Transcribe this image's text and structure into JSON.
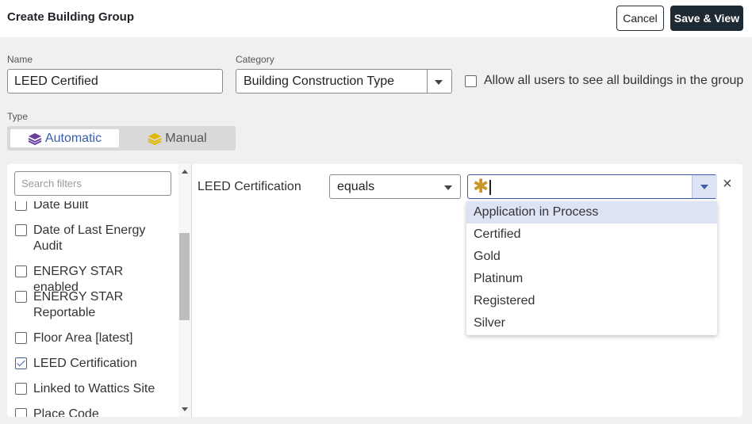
{
  "header": {
    "title": "Create Building Group",
    "cancel_label": "Cancel",
    "save_label": "Save & View"
  },
  "form": {
    "name_label": "Name",
    "name_value": "LEED Certified",
    "category_label": "Category",
    "category_value": "Building Construction Type",
    "allow_all_label": "Allow all users to see all buildings in the group",
    "allow_all_checked": false,
    "type_label": "Type",
    "type_automatic": "Automatic",
    "type_manual": "Manual",
    "type_selected": "Automatic"
  },
  "filters": {
    "search_placeholder": "Search filters",
    "items": [
      {
        "label": "Date Built",
        "checked": false
      },
      {
        "label": "Date of Last Energy Audit",
        "checked": false
      },
      {
        "label": "ENERGY STAR enabled",
        "checked": false
      },
      {
        "label": "ENERGY STAR Reportable",
        "checked": false
      },
      {
        "label": "Floor Area [latest]",
        "checked": false
      },
      {
        "label": "LEED Certification",
        "checked": true
      },
      {
        "label": "Linked to Wattics Site",
        "checked": false
      },
      {
        "label": "Place Code",
        "checked": false
      }
    ]
  },
  "rule": {
    "field_label": "LEED Certification",
    "operator_value": "equals",
    "value_text": "",
    "options": [
      "Application in Process",
      "Certified",
      "Gold",
      "Platinum",
      "Registered",
      "Silver"
    ],
    "highlighted_option": "Application in Process"
  },
  "colors": {
    "primary": "#1e2a33",
    "accent_blue": "#3a5ea8",
    "automatic_icon": "#6b3fa0",
    "manual_icon": "#e0b800",
    "asterisk": "#c9962a",
    "dropdown_highlight": "#dde3f5"
  },
  "icons": {
    "automatic": "layers-icon",
    "manual": "layers-icon",
    "required": "asterisk-icon",
    "clear": "close-icon"
  }
}
